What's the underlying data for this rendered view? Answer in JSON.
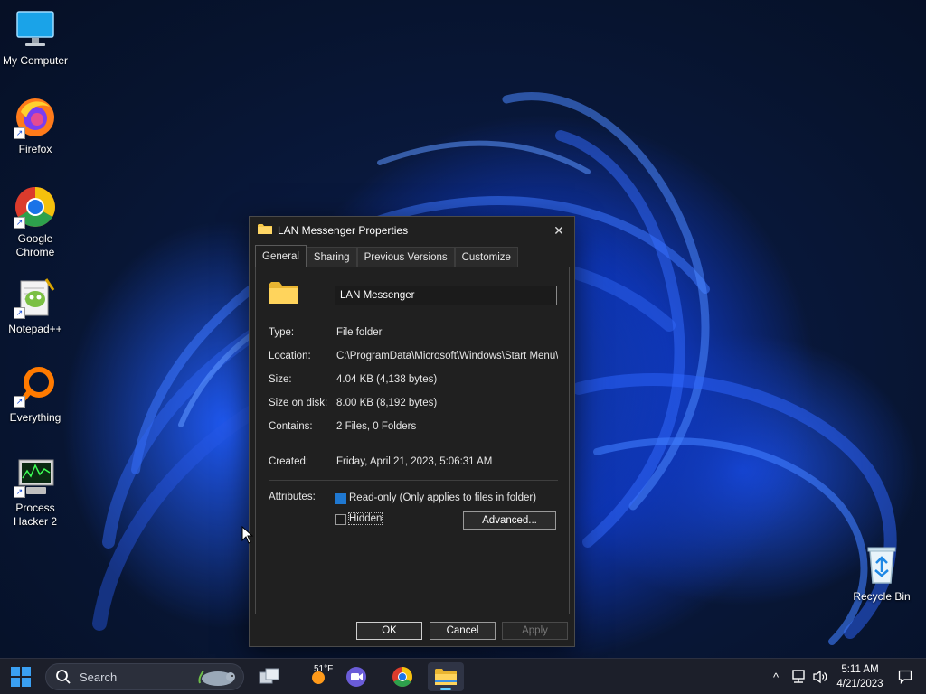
{
  "desktop": {
    "icons": [
      {
        "label": "My Computer",
        "icon": "monitor-icon"
      },
      {
        "label": "Firefox",
        "icon": "firefox-icon"
      },
      {
        "label": "Google Chrome",
        "icon": "chrome-icon"
      },
      {
        "label": "Notepad++",
        "icon": "notepadpp-icon"
      },
      {
        "label": "Everything",
        "icon": "everything-search-icon"
      },
      {
        "label": "Process Hacker 2",
        "icon": "process-hacker-icon"
      },
      {
        "label": "Recycle Bin",
        "icon": "recycle-bin-icon"
      }
    ]
  },
  "dialog": {
    "title": "LAN Messenger Properties",
    "close_glyph": "✕",
    "tabs": [
      "General",
      "Sharing",
      "Previous Versions",
      "Customize"
    ],
    "active_tab": "General",
    "name_value": "LAN Messenger",
    "fields": {
      "type_label": "Type:",
      "type_value": "File folder",
      "location_label": "Location:",
      "location_value": "C:\\ProgramData\\Microsoft\\Windows\\Start Menu\\Pr",
      "size_label": "Size:",
      "size_value": "4.04 KB (4,138 bytes)",
      "size_on_disk_label": "Size on disk:",
      "size_on_disk_value": "8.00 KB (8,192 bytes)",
      "contains_label": "Contains:",
      "contains_value": "2 Files, 0 Folders",
      "created_label": "Created:",
      "created_value": "Friday, April 21, 2023, 5:06:31 AM",
      "attributes_label": "Attributes:"
    },
    "attributes": {
      "readonly_label": "Read-only (Only applies to files in folder)",
      "readonly_state": "indeterminate",
      "hidden_label": "Hidden",
      "hidden_checked": false,
      "advanced_label": "Advanced..."
    },
    "buttons": {
      "ok": "OK",
      "cancel": "Cancel",
      "apply": "Apply"
    }
  },
  "taskbar": {
    "search_placeholder": "Search",
    "weather_temp": "51°F",
    "time": "5:11 AM",
    "date": "4/21/2023",
    "tray_chevron": "^",
    "colors": {
      "accent": "#60cdff",
      "taskbar_bg": "#1c1f2a"
    }
  }
}
